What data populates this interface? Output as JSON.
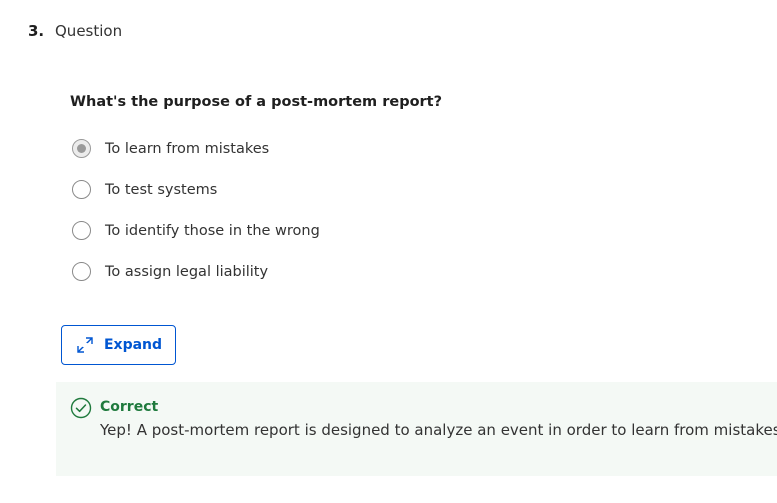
{
  "question": {
    "number": "3.",
    "label": "Question",
    "prompt": "What's the purpose of a post-mortem report?",
    "options": [
      {
        "label": "To learn from mistakes",
        "selected": true
      },
      {
        "label": "To test systems",
        "selected": false
      },
      {
        "label": "To identify those in the wrong",
        "selected": false
      },
      {
        "label": "To assign legal liability",
        "selected": false
      }
    ]
  },
  "expand": {
    "label": "Expand",
    "icon": "expand-arrows-icon"
  },
  "feedback": {
    "icon": "check-circle-icon",
    "status": "Correct",
    "message": "Yep! A post-mortem report is designed to analyze an event in order to learn from mistakes."
  },
  "colors": {
    "accent": "#0056d2",
    "success": "#1f7a3d",
    "feedback_bg": "#f4f9f5",
    "radio_selected": "#9a9a9a"
  }
}
